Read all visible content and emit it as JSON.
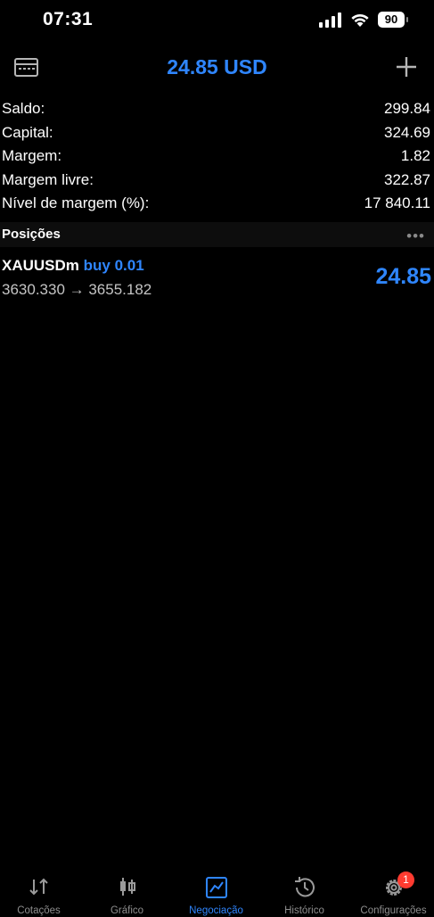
{
  "status_bar": {
    "time": "07:31",
    "battery": "90"
  },
  "header": {
    "title": "24.85 USD"
  },
  "summary": [
    {
      "label": "Saldo:",
      "value": "299.84"
    },
    {
      "label": "Capital:",
      "value": "324.69"
    },
    {
      "label": "Margem:",
      "value": "1.82"
    },
    {
      "label": "Margem livre:",
      "value": "322.87"
    },
    {
      "label": "Nível de margem (%):",
      "value": "17 840.11"
    }
  ],
  "positions": {
    "title": "Posições",
    "items": [
      {
        "symbol": "XAUUSDm",
        "side": "buy 0.01",
        "prices": "3630.330 → 3655.182",
        "profit": "24.85"
      }
    ]
  },
  "tabs": [
    {
      "label": "Cotações",
      "icon": "quotes-icon"
    },
    {
      "label": "Gráfico",
      "icon": "chart-icon"
    },
    {
      "label": "Negociação",
      "icon": "trade-icon"
    },
    {
      "label": "Histórico",
      "icon": "history-icon"
    },
    {
      "label": "Configurações",
      "icon": "settings-icon",
      "badge": "1"
    }
  ],
  "colors": {
    "accent": "#2f86ff",
    "badge": "#ff3b30",
    "background": "#000000"
  }
}
